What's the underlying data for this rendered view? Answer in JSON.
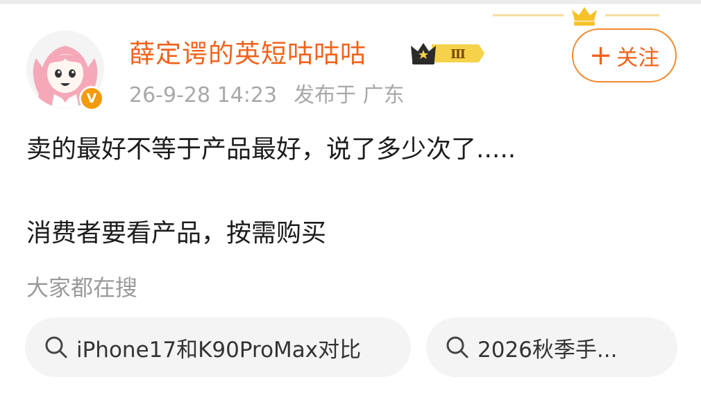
{
  "user": {
    "name": "薛定谔的英短咕咕咕",
    "vip_level": "Ⅲ",
    "verified_mark": "V"
  },
  "follow_button": {
    "plus": "+",
    "label": "关注"
  },
  "post": {
    "timestamp": "26-9-28 14:23",
    "location": "发布于 广东",
    "lines": [
      "卖的最好不等于产品最好，说了多少次了.....",
      "消费者要看产品，按需购买"
    ]
  },
  "hot_search": {
    "label": "大家都在搜",
    "items": [
      {
        "text": "iPhone17和K90ProMax对比",
        "icon": "search-icon"
      },
      {
        "text": "2026秋季手...",
        "icon": "search-icon"
      }
    ]
  },
  "colors": {
    "username": "#f0631c",
    "accent": "#f0892e",
    "badge": "#f39a0d",
    "meta": "#a8a8a8"
  }
}
